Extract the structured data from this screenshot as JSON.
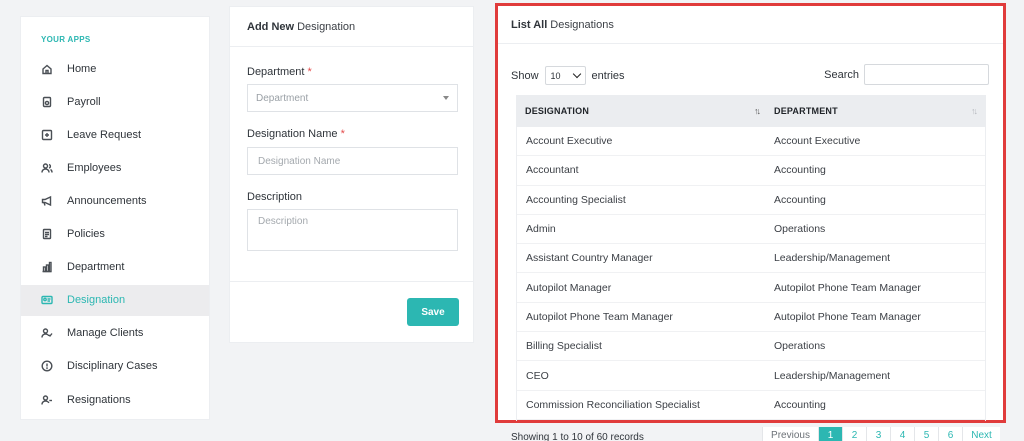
{
  "sidebar": {
    "title": "YOUR APPS",
    "items": [
      {
        "label": "Home",
        "icon": "home-icon"
      },
      {
        "label": "Payroll",
        "icon": "payroll-icon"
      },
      {
        "label": "Leave Request",
        "icon": "plus-square-icon"
      },
      {
        "label": "Employees",
        "icon": "users-icon"
      },
      {
        "label": "Announcements",
        "icon": "megaphone-icon"
      },
      {
        "label": "Policies",
        "icon": "document-icon"
      },
      {
        "label": "Department",
        "icon": "bar-chart-icon"
      },
      {
        "label": "Designation",
        "icon": "id-card-icon",
        "active": true
      },
      {
        "label": "Manage Clients",
        "icon": "user-check-icon"
      },
      {
        "label": "Disciplinary Cases",
        "icon": "alert-circle-icon"
      },
      {
        "label": "Resignations",
        "icon": "user-minus-icon"
      }
    ]
  },
  "add_form": {
    "title_bold": "Add New",
    "title_rest": "Designation",
    "department_label": "Department",
    "department_placeholder": "Department",
    "name_label": "Designation Name",
    "name_placeholder": "Designation Name",
    "description_label": "Description",
    "description_placeholder": "Description",
    "required_mark": "*",
    "save_label": "Save"
  },
  "list": {
    "title_bold": "List All",
    "title_rest": "Designations",
    "show_label": "Show",
    "entries_value": "10",
    "entries_label": "entries",
    "search_label": "Search",
    "columns": [
      "DESIGNATION",
      "DEPARTMENT"
    ],
    "rows": [
      [
        "Account Executive",
        "Account Executive"
      ],
      [
        "Accountant",
        "Accounting"
      ],
      [
        "Accounting Specialist",
        "Accounting"
      ],
      [
        "Admin",
        "Operations"
      ],
      [
        "Assistant Country Manager",
        "Leadership/Management"
      ],
      [
        "Autopilot Manager",
        "Autopilot Phone Team Manager"
      ],
      [
        "Autopilot Phone Team Manager",
        "Autopilot Phone Team Manager"
      ],
      [
        "Billing Specialist",
        "Operations"
      ],
      [
        "CEO",
        "Leadership/Management"
      ],
      [
        "Commission Reconciliation Specialist",
        "Accounting"
      ]
    ],
    "showing_text": "Showing 1 to 10 of 60 records",
    "pagination": {
      "prev": "Previous",
      "pages": [
        "1",
        "2",
        "3",
        "4",
        "5",
        "6"
      ],
      "current": "1",
      "next": "Next"
    }
  },
  "colors": {
    "accent": "#2cb7b2",
    "highlight_border": "#e03b3b",
    "required": "#e34b4b"
  }
}
